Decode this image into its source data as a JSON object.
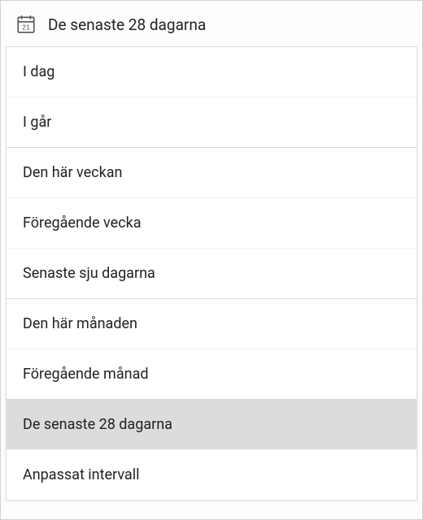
{
  "header": {
    "title": "De senaste 28 dagarna",
    "calendar_day": "21"
  },
  "options": [
    {
      "label": "I dag",
      "selected": false,
      "group_end": false
    },
    {
      "label": "I går",
      "selected": false,
      "group_end": true
    },
    {
      "label": "Den här veckan",
      "selected": false,
      "group_end": false
    },
    {
      "label": "Föregående vecka",
      "selected": false,
      "group_end": false
    },
    {
      "label": "Senaste sju dagarna",
      "selected": false,
      "group_end": true
    },
    {
      "label": "Den här månaden",
      "selected": false,
      "group_end": false
    },
    {
      "label": "Föregående månad",
      "selected": false,
      "group_end": true
    },
    {
      "label": "De senaste 28 dagarna",
      "selected": true,
      "group_end": false
    },
    {
      "label": "Anpassat intervall",
      "selected": false,
      "group_end": false
    }
  ]
}
